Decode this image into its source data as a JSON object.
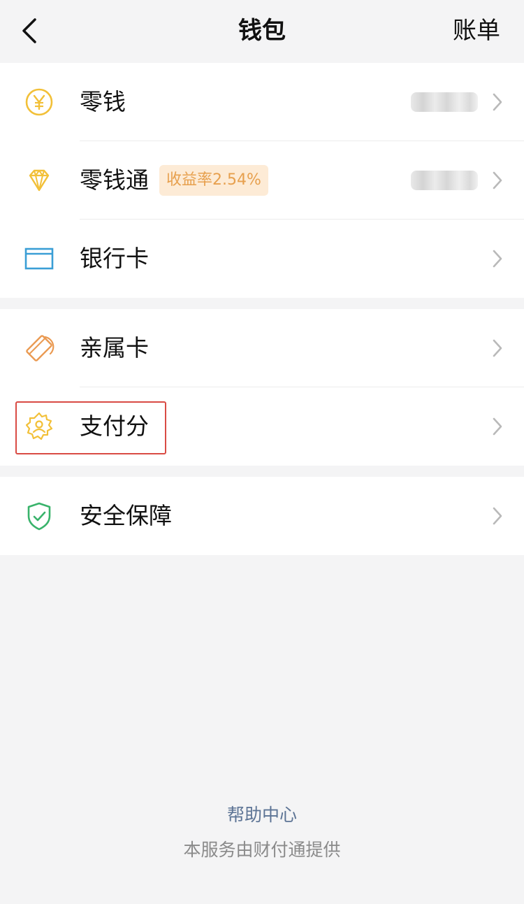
{
  "navbar": {
    "title": "钱包",
    "right_label": "账单",
    "back_icon": "chevron-left-icon"
  },
  "group1": {
    "items": [
      {
        "label": "零钱",
        "icon": "yuan-coin-icon",
        "value_hidden": true
      },
      {
        "label": "零钱通",
        "icon": "diamond-icon",
        "badge": "收益率2.54%",
        "value_hidden": true
      },
      {
        "label": "银行卡",
        "icon": "bank-card-icon"
      }
    ]
  },
  "group2": {
    "items": [
      {
        "label": "亲属卡",
        "icon": "family-card-icon"
      },
      {
        "label": "支付分",
        "icon": "badge-user-icon",
        "highlighted": true
      }
    ]
  },
  "group3": {
    "items": [
      {
        "label": "安全保障",
        "icon": "shield-check-icon"
      }
    ]
  },
  "footer": {
    "help_link": "帮助中心",
    "provider_note": "本服务由财付通提供"
  },
  "colors": {
    "background": "#f4f4f5",
    "card": "#ffffff",
    "yellow_icon": "#f2c038",
    "blue_icon": "#3a9ed6",
    "orange_icon": "#ea9a52",
    "green_icon": "#39b36b",
    "badge_bg": "#fdebd6",
    "badge_text": "#e7a04e",
    "highlight_border": "#d94b44",
    "link": "#5d7495"
  }
}
